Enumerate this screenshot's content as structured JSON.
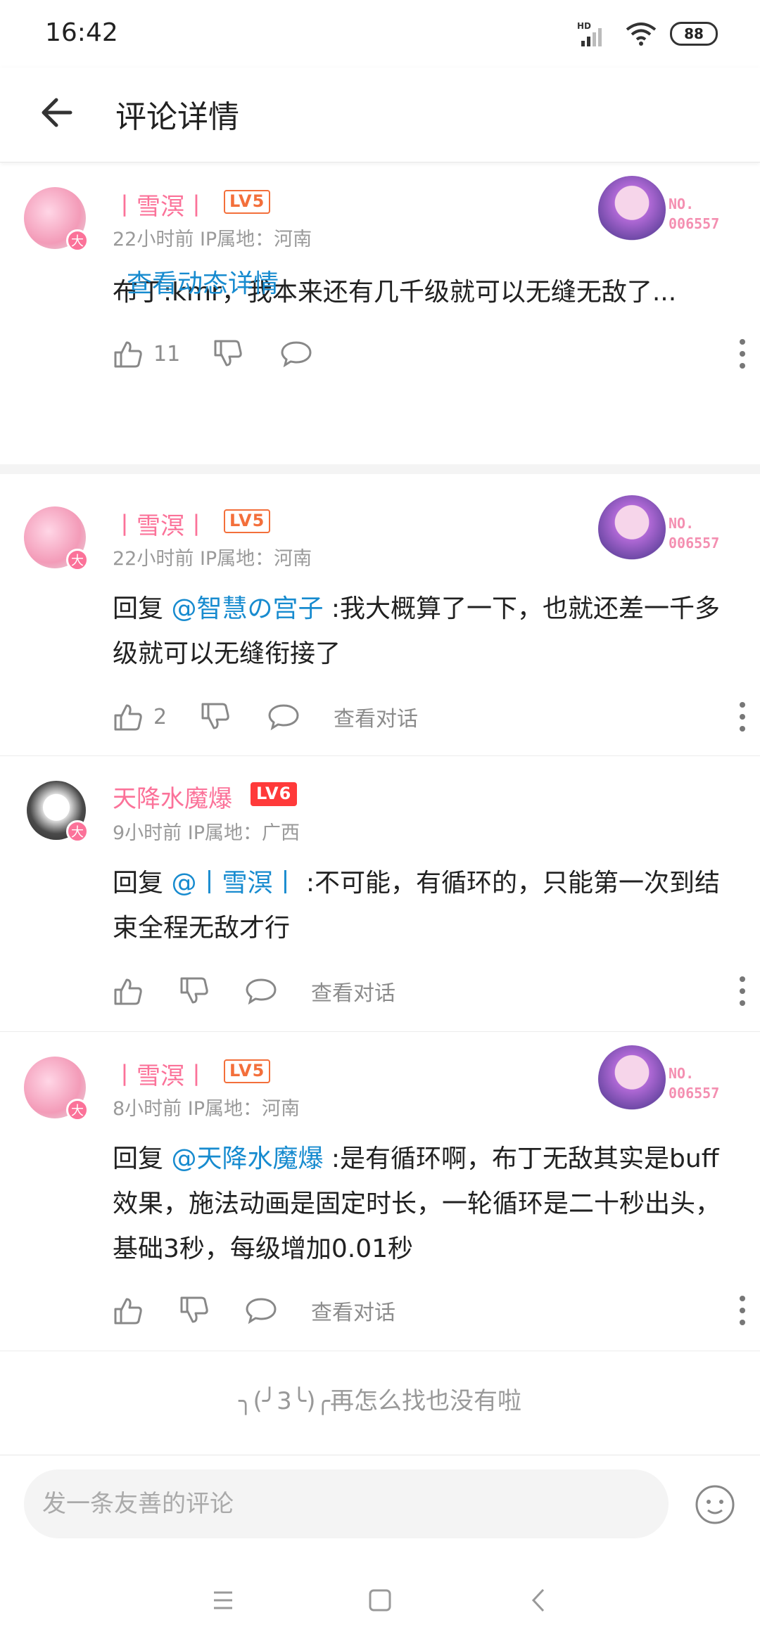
{
  "status": {
    "time": "16:42",
    "battery": "88",
    "network": "HD"
  },
  "header": {
    "title": "评论详情"
  },
  "comments": [
    {
      "user": "丨雪溟丨",
      "level": "LV5",
      "meta": "22小时前  IP属地：河南",
      "badge": "NO.\n006557",
      "text": "布丁:kmr，我本来还有几千级就可以无缝无敌了...",
      "likes": "11",
      "link": "查看动态详情"
    },
    {
      "user": "丨雪溟丨",
      "level": "LV5",
      "meta": "22小时前  IP属地：河南",
      "badge": "NO.\n006557",
      "reply_prefix": "回复 ",
      "mention": "@智慧の宫子",
      "text": " :我大概算了一下，也就还差一千多级就可以无缝衔接了",
      "likes": "2",
      "conv": "查看对话"
    },
    {
      "user": "天降水魔爆",
      "level": "LV6",
      "meta": "9小时前  IP属地：广西",
      "reply_prefix": "回复 ",
      "mention": "@丨雪溟丨",
      "text": " :不可能，有循环的，只能第一次到结束全程无敌才行",
      "conv": "查看对话"
    },
    {
      "user": "丨雪溟丨",
      "level": "LV5",
      "meta": "8小时前  IP属地：河南",
      "badge": "NO.\n006557",
      "reply_prefix": "回复 ",
      "mention": "@天降水魔爆",
      "text": " :是有循环啊，布丁无敌其实是buff效果，施法动画是固定时长，一轮循环是二十秒出头，基础3秒，每级增加0.01秒",
      "conv": "查看对话"
    }
  ],
  "avatar_badge": "大",
  "footer": {
    "no_more": "╮(╯3╰)╭再怎么找也没有啦",
    "input_placeholder": "发一条友善的评论"
  },
  "colors": {
    "username": "#fb7299",
    "link": "#178bcf",
    "level5": "#f36f3b",
    "level6": "#ff3a3a"
  }
}
